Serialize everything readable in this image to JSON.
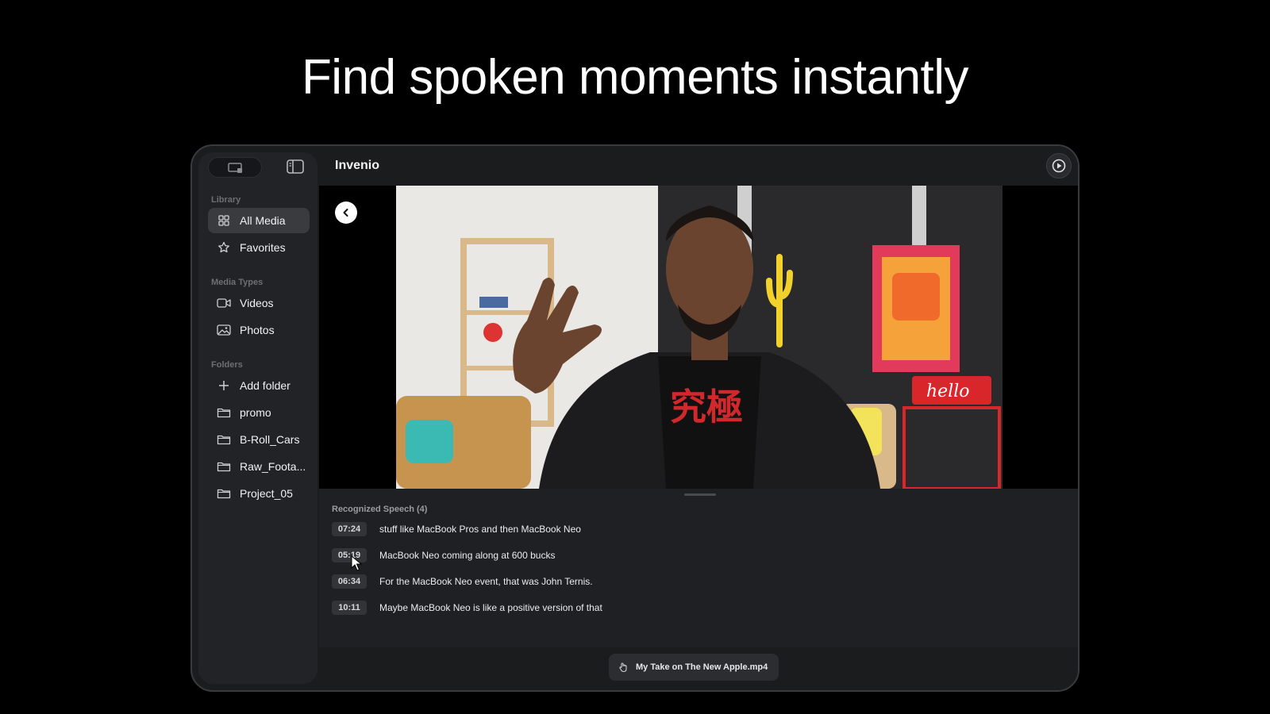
{
  "headline": "Find spoken moments instantly",
  "app": {
    "title": "Invenio"
  },
  "sidebar": {
    "sections": {
      "library": "Library",
      "media_types": "Media Types",
      "folders": "Folders"
    },
    "library_items": [
      {
        "label": "All Media",
        "icon": "grid-icon",
        "active": true
      },
      {
        "label": "Favorites",
        "icon": "star-icon",
        "active": false
      }
    ],
    "media_type_items": [
      {
        "label": "Videos",
        "icon": "video-camera-icon"
      },
      {
        "label": "Photos",
        "icon": "photo-icon"
      }
    ],
    "folder_items": [
      {
        "label": "Add folder",
        "icon": "plus-icon"
      },
      {
        "label": "promo",
        "icon": "folder-icon"
      },
      {
        "label": "B-Roll_Cars",
        "icon": "folder-icon"
      },
      {
        "label": "Raw_Foota...",
        "icon": "folder-icon"
      },
      {
        "label": "Project_05",
        "icon": "folder-icon"
      }
    ]
  },
  "speech": {
    "title": "Recognized Speech (4)",
    "results": [
      {
        "time": "07:24",
        "text": "stuff like MacBook Pros and then MacBook Neo"
      },
      {
        "time": "05:19",
        "text": "MacBook Neo coming along at 600 bucks"
      },
      {
        "time": "06:34",
        "text": "For the MacBook Neo event, that was John Ternis."
      },
      {
        "time": "10:11",
        "text": "Maybe MacBook Neo is like a positive version of that"
      }
    ]
  },
  "footer": {
    "file_name": "My Take on The New Apple.mp4",
    "icon": "hand-pointer-icon"
  },
  "colors": {
    "background": "#000000",
    "window": "#1b1c1e",
    "sidebar": "#222326",
    "active_item": "#3a3b3f"
  }
}
